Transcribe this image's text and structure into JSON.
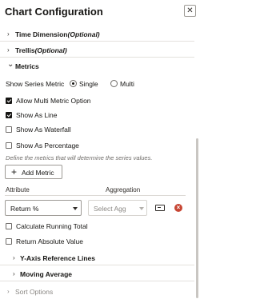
{
  "header": {
    "title": "Chart Configuration",
    "close_glyph": "✕"
  },
  "sections": {
    "time_dimension": {
      "label": "Time Dimension",
      "optional": "(Optional)"
    },
    "trellis": {
      "label": "Trellis",
      "optional": "(Optional)"
    },
    "metrics": {
      "label": "Metrics"
    },
    "y_axis": {
      "label": "Y-Axis Reference Lines"
    },
    "moving_average": {
      "label": "Moving Average"
    },
    "sort_options": {
      "label": "Sort Options"
    }
  },
  "metrics": {
    "show_series_metric_label": "Show Series Metric",
    "single_label": "Single",
    "multi_label": "Multi",
    "selected_mode": "Single",
    "allow_multi_label": "Allow Multi Metric Option",
    "allow_multi_checked": true,
    "show_as_line_label": "Show As Line",
    "show_as_line_checked": true,
    "show_as_waterfall_label": "Show As Waterfall",
    "show_as_waterfall_checked": false,
    "show_as_percentage_label": "Show As Percentage",
    "show_as_percentage_checked": false,
    "hint": "Define the metrics that will determine the series values.",
    "add_metric_label": "Add Metric",
    "add_glyph": "+",
    "attribute_header": "Attribute",
    "aggregation_header": "Aggregation",
    "attribute_value": "Return %",
    "aggregation_placeholder": "Select Agg",
    "calc_running_total_label": "Calculate Running Total",
    "return_absolute_label": "Return Absolute Value"
  },
  "chevrons": {
    "collapsed": "›",
    "expanded": "⌄"
  },
  "icons": {
    "delete_glyph": "×"
  },
  "colors": {
    "delete_red": "#c74634",
    "text": "#161513",
    "hint": "#6f6c69"
  }
}
